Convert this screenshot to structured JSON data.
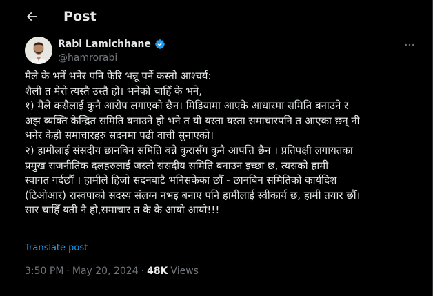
{
  "header": {
    "title": "Post",
    "back_icon": "arrow-left-icon"
  },
  "author": {
    "display_name": "Rabi Lamichhane",
    "handle": "@hamrorabi",
    "verified": true,
    "verified_color": "#1d9bf0"
  },
  "post": {
    "lines": [
      "मैले के भनें भनेर पनि फेरि भन्नू पर्ने कस्तो आश्चर्य:",
      "शैली त मेरो त्यस्तै उस्तै हो। भनेको चाहिँ के भने,",
      "१) मैले कसैलाई कुनै आरोप लगाएको छैन। मिडियामा आएके आधारमा समिति बनाउने र",
      "अझ ब्यक्ति केन्द्रित समिति बनाउने हो भने त यी यस्ता यस्ता समाचारपनि त आएका छन् नी",
      "भनेर केही समाचारहरु सदनमा पढी वाची सुनाएको।",
      "२) हामीलाई संसदीय छानबिन समिति बन्ने कुरासँग कुनै आपत्ति छैन । प्रतिपक्षी लगायतका",
      "प्रमुख राजनीतिक दलहरुलाई जस्तो संसदीय समिति बनाउन इच्छा छ, त्यसको हामी",
      "स्वागत गर्दछौँ । हामीले हिजो सदनबाटै भनिसकेका छौँ - छानबिन समितिको कार्यदिश",
      "(टिओआर) रास्वपाको सदस्य संलग्न नभइ बनाए पनि हामीलाई स्वीकार्य छ, हामी तयार छौँ।",
      "सार चाहिँ यती नै हो,समाचार त के के आयो आयो!!!"
    ],
    "translate_label": "Translate post",
    "time": "3:50 PM",
    "separator": "·",
    "date": "May 20, 2024",
    "views_count": "48K",
    "views_label": "Views"
  },
  "colors": {
    "background": "#000000",
    "text_primary": "#e7e9ea",
    "text_secondary": "#71767b",
    "accent": "#1d9bf0"
  }
}
